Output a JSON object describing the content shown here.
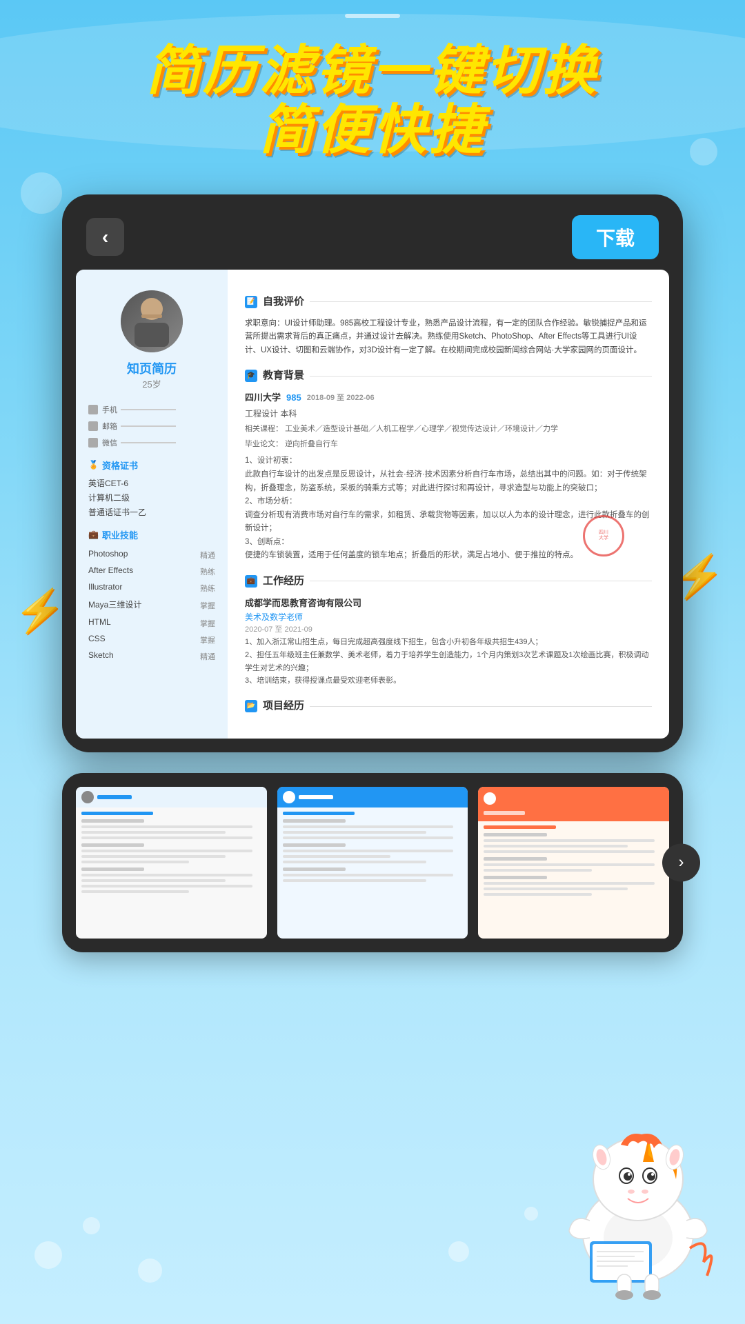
{
  "app": {
    "title_line1": "简历滤镜一键切换",
    "title_line2": "简便快捷"
  },
  "device": {
    "back_button_icon": "‹",
    "download_button": "下载"
  },
  "resume": {
    "brand": "知页简历",
    "age": "25岁",
    "contact": {
      "phone_label": "手机",
      "email_label": "邮箱",
      "wechat_label": "微信"
    },
    "certificates_title": "资格证书",
    "certificates": [
      "英语CET-6",
      "计算机二级",
      "普通话证书一乙"
    ],
    "skills_title": "职业技能",
    "skills": [
      {
        "name": "Photoshop",
        "level": "精通"
      },
      {
        "name": "After Effects",
        "level": "熟练"
      },
      {
        "name": "Illustrator",
        "level": "熟练"
      },
      {
        "name": "Maya三维设计",
        "level": "掌握"
      },
      {
        "name": "HTML",
        "level": "掌握"
      },
      {
        "name": "CSS",
        "level": "掌握"
      },
      {
        "name": "Sketch",
        "level": "精通"
      }
    ],
    "self_eval_title": "自我评价",
    "self_eval_text": "求职意向：UI设计师助理。985高校工程设计专业，熟悉产品设计流程，有一定的团队合作经验。敏锐捕捉产品和运营所提出需求背后的真正痛点，并通过设计去解决。熟练使用Sketch、PhotoShop、After Effects等工具进行UI设计、UX设计、切图和云端协作，对3D设计有一定了解。在校期间完成校园新闻综合网站·大学家园网的页面设计。",
    "education_title": "教育背景",
    "education": {
      "school": "四川大学",
      "score": "985",
      "date_start": "2018-09",
      "date_end": "2022-06",
      "degree": "工程设计 本科",
      "courses_label": "相关课程：",
      "courses": "工业美术／造型设计基础／人机工程学／心理学／视觉传达设计／环境设计／力学",
      "thesis_label": "毕业论文：",
      "thesis": "逆向折叠自行车",
      "thesis_desc1": "1、设计初衷：",
      "desc1": "此款自行车设计的出发点是反思设计，从社会·经济·技术因素分析自行车市场，总结出其中的问题。如：对于传统架构，折叠理念，防盗系统，采板的骑乘方式等；对此进行探讨和再设计，寻求造型与功能上的突破口；",
      "thesis_desc2": "2、市场分析：",
      "desc2": "调查分析现有消费市场对自行车的需求，如租赁、承载货物等因素，加以以人为本的设计理念，进行此款折叠车的创新设计；",
      "thesis_desc3": "3、创断点：",
      "desc3": "便捷的车锁装置，适用于任何盖度的锁车地点；折叠后的形状，满足占地小、便于推拉的特点。"
    },
    "work_title": "工作经历",
    "work": {
      "company": "成都学而思教育咨询有限公司",
      "role": "美术及数学老师",
      "date": "2020-07 至 2021-09",
      "desc1": "1、加入浙江常山招生点，每日完成超高强度线下招生，包含小升初各年级共招生439人；",
      "desc2": "2、担任五年级班主任兼数学、美术老师，着力于培养学生创造能力，1个月内策划3次艺术课题及1次绘画比赛，积极调动学生对艺术的兴趣；",
      "desc3": "3、培训结束，获得授课点最受欢迎老师表彰。"
    },
    "project_title": "项目经历"
  },
  "thumbnails": [
    {
      "id": 1,
      "style": "clean"
    },
    {
      "id": 2,
      "style": "modern"
    },
    {
      "id": 3,
      "style": "colorful"
    }
  ],
  "nav": {
    "next_icon": "›"
  }
}
